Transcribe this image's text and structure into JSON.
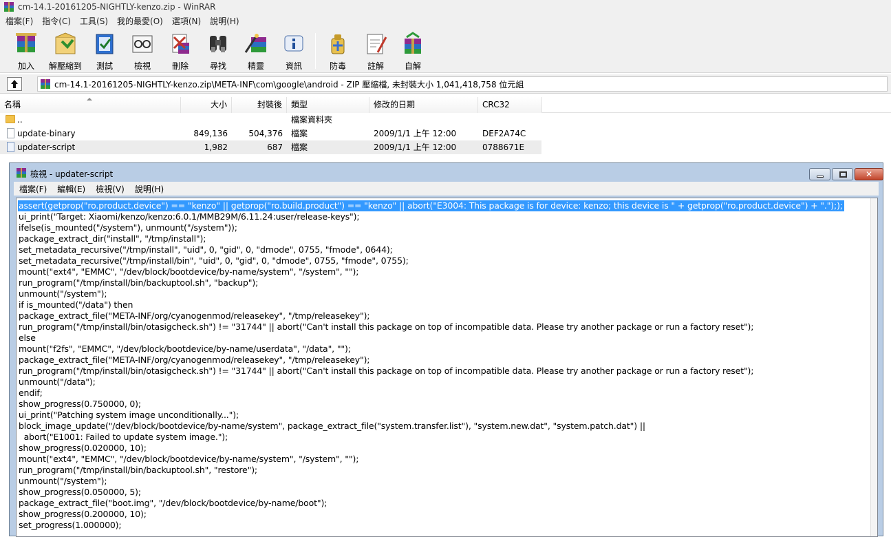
{
  "window": {
    "title": "cm-14.1-20161205-NIGHTLY-kenzo.zip - WinRAR"
  },
  "menu": [
    "檔案(F)",
    "指令(C)",
    "工具(S)",
    "我的最愛(O)",
    "選項(N)",
    "說明(H)"
  ],
  "toolbar": [
    {
      "label": "加入",
      "icon": "add-archive-icon"
    },
    {
      "label": "解壓縮到",
      "icon": "extract-to-icon"
    },
    {
      "label": "測試",
      "icon": "test-icon"
    },
    {
      "label": "檢視",
      "icon": "view-icon"
    },
    {
      "label": "刪除",
      "icon": "delete-icon"
    },
    {
      "label": "尋找",
      "icon": "find-icon"
    },
    {
      "label": "精靈",
      "icon": "wizard-icon"
    },
    {
      "label": "資訊",
      "icon": "info-icon"
    },
    {
      "label": "防毒",
      "icon": "virus-scan-icon"
    },
    {
      "label": "註解",
      "icon": "comment-icon"
    },
    {
      "label": "自解",
      "icon": "sfx-icon"
    }
  ],
  "path": {
    "text": "cm-14.1-20161205-NIGHTLY-kenzo.zip\\META-INF\\com\\google\\android - ZIP 壓縮檔, 未封裝大小 1,041,418,758 位元組"
  },
  "columns": [
    "名稱",
    "大小",
    "封裝後",
    "類型",
    "修改的日期",
    "CRC32"
  ],
  "files": [
    {
      "name": "..",
      "size": "",
      "packed": "",
      "type": "檔案資料夾",
      "modified": "",
      "crc": "",
      "kind": "folder"
    },
    {
      "name": "update-binary",
      "size": "849,136",
      "packed": "504,376",
      "type": "檔案",
      "modified": "2009/1/1 上午 12:00",
      "crc": "DEF2A74C",
      "kind": "file"
    },
    {
      "name": "updater-script",
      "size": "1,982",
      "packed": "687",
      "type": "檔案",
      "modified": "2009/1/1 上午 12:00",
      "crc": "0788671E",
      "kind": "file-selected"
    }
  ],
  "viewer": {
    "title": "檢視 - updater-script",
    "menu": [
      "檔案(F)",
      "編輯(E)",
      "檢視(V)",
      "說明(H)"
    ],
    "lines": [
      "assert(getprop(\"ro.product.device\") == \"kenzo\" || getprop(\"ro.build.product\") == \"kenzo\" || abort(\"E3004: This package is for device: kenzo; this device is \" + getprop(\"ro.product.device\") + \".\"););",
      "ui_print(\"Target: Xiaomi/kenzo/kenzo:6.0.1/MMB29M/6.11.24:user/release-keys\");",
      "ifelse(is_mounted(\"/system\"), unmount(\"/system\"));",
      "package_extract_dir(\"install\", \"/tmp/install\");",
      "set_metadata_recursive(\"/tmp/install\", \"uid\", 0, \"gid\", 0, \"dmode\", 0755, \"fmode\", 0644);",
      "set_metadata_recursive(\"/tmp/install/bin\", \"uid\", 0, \"gid\", 0, \"dmode\", 0755, \"fmode\", 0755);",
      "mount(\"ext4\", \"EMMC\", \"/dev/block/bootdevice/by-name/system\", \"/system\", \"\");",
      "run_program(\"/tmp/install/bin/backuptool.sh\", \"backup\");",
      "unmount(\"/system\");",
      "if is_mounted(\"/data\") then",
      "package_extract_file(\"META-INF/org/cyanogenmod/releasekey\", \"/tmp/releasekey\");",
      "run_program(\"/tmp/install/bin/otasigcheck.sh\") != \"31744\" || abort(\"Can't install this package on top of incompatible data. Please try another package or run a factory reset\");",
      "else",
      "mount(\"f2fs\", \"EMMC\", \"/dev/block/bootdevice/by-name/userdata\", \"/data\", \"\");",
      "package_extract_file(\"META-INF/org/cyanogenmod/releasekey\", \"/tmp/releasekey\");",
      "run_program(\"/tmp/install/bin/otasigcheck.sh\") != \"31744\" || abort(\"Can't install this package on top of incompatible data. Please try another package or run a factory reset\");",
      "unmount(\"/data\");",
      "endif;",
      "show_progress(0.750000, 0);",
      "ui_print(\"Patching system image unconditionally...\");",
      "block_image_update(\"/dev/block/bootdevice/by-name/system\", package_extract_file(\"system.transfer.list\"), \"system.new.dat\", \"system.patch.dat\") ||",
      "  abort(\"E1001: Failed to update system image.\");",
      "show_progress(0.020000, 10);",
      "mount(\"ext4\", \"EMMC\", \"/dev/block/bootdevice/by-name/system\", \"/system\", \"\");",
      "run_program(\"/tmp/install/bin/backuptool.sh\", \"restore\");",
      "unmount(\"/system\");",
      "show_progress(0.050000, 5);",
      "package_extract_file(\"boot.img\", \"/dev/block/bootdevice/by-name/boot\");",
      "show_progress(0.200000, 10);",
      "set_progress(1.000000);"
    ]
  }
}
